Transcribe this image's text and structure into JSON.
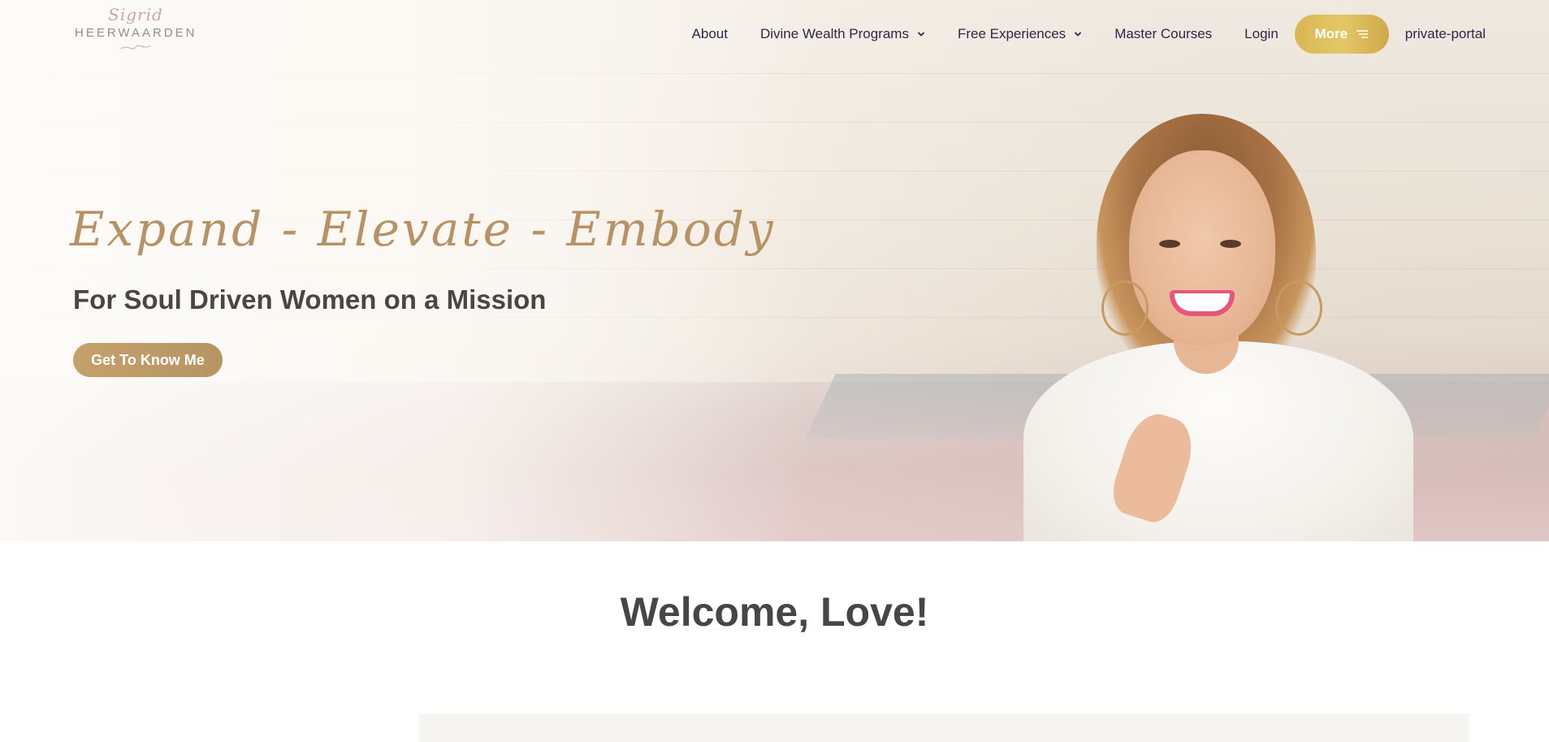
{
  "logo": {
    "script": "Sigrid",
    "name": "HEERWAARDEN"
  },
  "nav": {
    "items": [
      {
        "label": "About"
      },
      {
        "label": "Divine Wealth Programs"
      },
      {
        "label": "Free Experiences"
      },
      {
        "label": "Master Courses"
      },
      {
        "label": "Login"
      }
    ],
    "more_label": "More",
    "portal_label": "private-portal"
  },
  "hero": {
    "tagline": "Expand - Elevate - Embody",
    "subtitle": "For Soul Driven Women on a Mission",
    "cta_label": "Get To Know Me"
  },
  "welcome": {
    "title": "Welcome, Love!"
  },
  "colors": {
    "gold_accent": "#b89165",
    "more_button": "#d9b752",
    "nav_text": "#2b2848",
    "heading_text": "#464646"
  }
}
